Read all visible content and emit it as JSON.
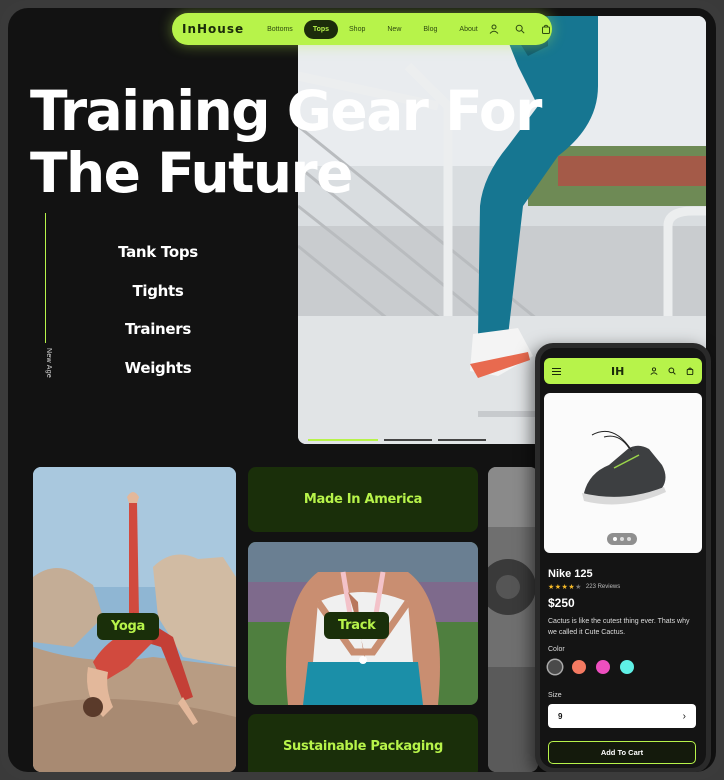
{
  "nav": {
    "brand": "InHouse",
    "links": [
      "Bottoms",
      "Tops",
      "Shop",
      "New",
      "Blog",
      "About"
    ],
    "active": "Tops",
    "icons": [
      "user-icon",
      "search-icon",
      "cart-icon"
    ]
  },
  "hero": {
    "title_line1": "Training Gear For",
    "title_line2": "The Future",
    "side_tag": "New Age",
    "categories": [
      "Tank Tops",
      "Tights",
      "Trainers",
      "Weights"
    ]
  },
  "tiles": {
    "yoga": "Yoga",
    "made_in": "Made In America",
    "track": "Track",
    "packaging": "Sustainable Packaging"
  },
  "phone": {
    "logo": "IH",
    "product": {
      "name": "Nike 125",
      "rating": 4,
      "reviews": "223 Reviews",
      "price": "$250",
      "description": "Cactus is like the cutest thing ever. Thats why we called it Cute Cactus.",
      "color_label": "Color",
      "colors": [
        "#4a4a4a",
        "#f47a62",
        "#ee4fbf",
        "#5ff0e6"
      ],
      "size_label": "Size",
      "size_value": "9",
      "cart_button": "Add To Cart"
    }
  },
  "colors": {
    "accent": "#b7f34a",
    "background": "#121212",
    "tile_dark": "#1a2f0a"
  }
}
